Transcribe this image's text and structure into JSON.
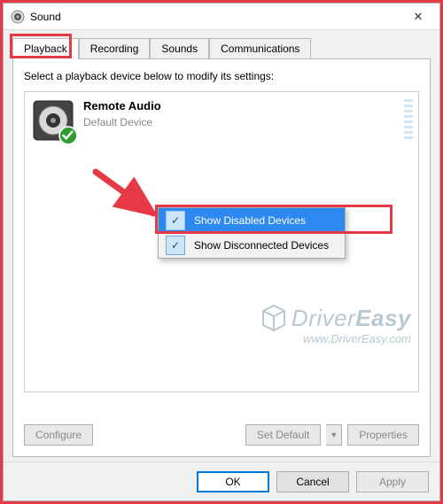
{
  "window": {
    "title": "Sound",
    "close_glyph": "✕"
  },
  "tabs": {
    "playback": "Playback",
    "recording": "Recording",
    "sounds": "Sounds",
    "communications": "Communications"
  },
  "instruction": "Select a playback device below to modify its settings:",
  "device": {
    "name": "Remote Audio",
    "status": "Default Device"
  },
  "context_menu": {
    "show_disabled": "Show Disabled Devices",
    "show_disconnected": "Show Disconnected Devices"
  },
  "buttons": {
    "configure": "Configure",
    "set_default": "Set Default",
    "properties": "Properties",
    "ok": "OK",
    "cancel": "Cancel",
    "apply": "Apply"
  },
  "watermark": {
    "brand1": "Driver",
    "brand2": "Easy",
    "url": "www.DriverEasy.com"
  }
}
